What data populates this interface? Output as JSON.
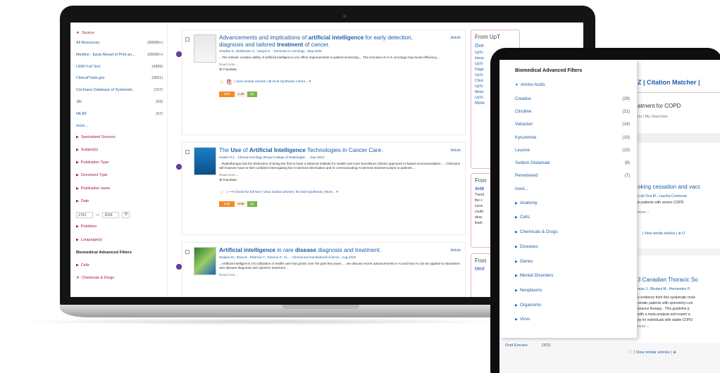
{
  "filters": {
    "source_title": "Source",
    "sources": [
      {
        "label": "All Resources",
        "count": "(99999+)"
      },
      {
        "label": "Medline - Epub Ahead of Print an...",
        "count": "(26000+)"
      },
      {
        "label": "LWW Full Text",
        "count": "(4389)"
      },
      {
        "label": "ClinicalTrials.gov",
        "count": "(3061)"
      },
      {
        "label": "Cochrane Database of Systemati...",
        "count": "(157)"
      },
      {
        "label": "JBI",
        "count": "(63)"
      },
      {
        "label": "NEJM",
        "count": "(57)"
      }
    ],
    "more": "more...",
    "sections_a": [
      "Specialized Sources",
      "Subject(s)",
      "Publication Type",
      "Document Type",
      "Publication name",
      "Date"
    ],
    "date_from": "1753",
    "date_sep": "—",
    "date_to": "2026",
    "date_search": "⚲",
    "sections_b": [
      "Publisher",
      "Language(s)"
    ],
    "bma_title": "Biomedical Advanced Filters",
    "sections_c": [
      "Cells"
    ],
    "expanded_section": "Chemicals & Drugs"
  },
  "results": [
    {
      "title_parts": [
        "Advancements and implications of ",
        "artificial intelligence",
        " for early detection, diagnosis and tailored ",
        "treatment",
        " of cancer."
      ],
      "type": "Article",
      "authors": "Chadha S., Mukherjee S., Sanyal S. - Seminars in oncology , May-2025",
      "abstract": "...The intrinsic creative ability of artificial intelligence (AI) offers improvements in patient screening.... The inclusion of AI in oncology may boost efficiency,...",
      "read_more": "Read more ⌄",
      "translate": "Translate",
      "actions": "| View similar articles | ⊕ Ovid Synthesis | More... ▾",
      "sjr_label": "SJR",
      "sjr_value": "1.20",
      "quartile": "Q1"
    },
    {
      "title_parts": [
        "The ",
        "Use",
        " of ",
        "Artificial Intelligence",
        " Technologies in Cancer Care."
      ],
      "type": "Article",
      "authors": "Hoskin P.J. - Clinical oncology (Royal College of Radiologist... , Sep-2024",
      "abstract": "...Radiotherapy has the distinction of being the first to have a National Institute for Health and Care Excellence (NICE)-approved AI-based recommendation. ... Clinicians will however have to feel confident interrogating the AI-derived information and in communicating AI-derived treatment plans to patients....",
      "read_more": "Read more ⌄",
      "translate": "Translate",
      "actions": "| ⟶ Check for full text | View similar articles | ⊕ Ovid Synthesis | More... ▾",
      "sjr_label": "SJR",
      "sjr_value": "0.96",
      "quartile": "Q1"
    },
    {
      "title_parts": [
        "Artificial intelligence",
        " in rare ",
        "disease",
        " diagnosis and treatment."
      ],
      "type": "Article",
      "authors": "Wojtara M., Rana E., Rahman T., Khanna P., Si... - Clinical and translational science , Aug-2023",
      "abstract": "...Artificial intelligence (AI) utilization in health care has grown over the past few years. ... we discuss recent advancements in AI and how AI can be applied to streamline rare disease diagnosis and optimize treatment...",
      "read_more": "Read more ⌄"
    }
  ],
  "side": {
    "box1_title": "From UpT",
    "box1_links": [
      "Ove",
      "UpTo",
      "",
      "Interp",
      "UpTo",
      "",
      "Diagn",
      "UpTo",
      "",
      "Clinic",
      "UpTo",
      "",
      "Melar",
      "UpTo",
      "",
      "More"
    ],
    "box2_title": "Fron",
    "box2_lines": [
      "Artil",
      "Trend",
      "the c",
      "curre",
      "could",
      "desc",
      "leam"
    ],
    "box3_title": "Fron",
    "box3_link": "Med"
  },
  "tablet": {
    "back_header": "Z | Citation Matcher |",
    "back_query": "atment for COPD",
    "back_sub": "rts | My Searches",
    "back_r1_title": "oking cessation and vacc",
    "back_r1_auth": "n de Oca M., Laucho-Contreras",
    "back_r1_abs": "in patients with severe COPD.",
    "back_r1_more": "more ⌄",
    "back_r1_act": "| View similar articles | ⊕ O",
    "back_r2_title": "3 Canadian Thoracic So",
    "back_r2_auth": "reau J., Bhutani M., Hernandez P.,",
    "back_r2_lines": [
      "e evidence from this systematic revie",
      "omatic patients with spirometry-con",
      "enance therapy . This guideline p",
      "with a meta-analysis and expert a",
      "py for individuals with stable COPD"
    ],
    "back_r2_more": "more ⌄",
    "footer_label": "Ovid Emcare",
    "footer_count": "(302)",
    "footer_act": "| View similar articles | ⊕",
    "panel_title": "Biomedical Advanced Filters",
    "expanded": "Amino Acids",
    "items": [
      {
        "label": "Creatine",
        "count": "(29)"
      },
      {
        "label": "Citrulline",
        "count": "(21)"
      },
      {
        "label": "Valsartan",
        "count": "(14)"
      },
      {
        "label": "Kynurenine",
        "count": "(10)"
      },
      {
        "label": "Leucine",
        "count": "(10)"
      },
      {
        "label": "Sodium Glutamate",
        "count": "(8)"
      },
      {
        "label": "Pemetrexed",
        "count": "(7)"
      }
    ],
    "more": "more...",
    "sections": [
      "Anatomy",
      "Cells",
      "Chemicals & Drugs",
      "Diseases",
      "Genes",
      "Mental Disorders",
      "Neoplasms",
      "Organisms",
      "Virus"
    ]
  }
}
